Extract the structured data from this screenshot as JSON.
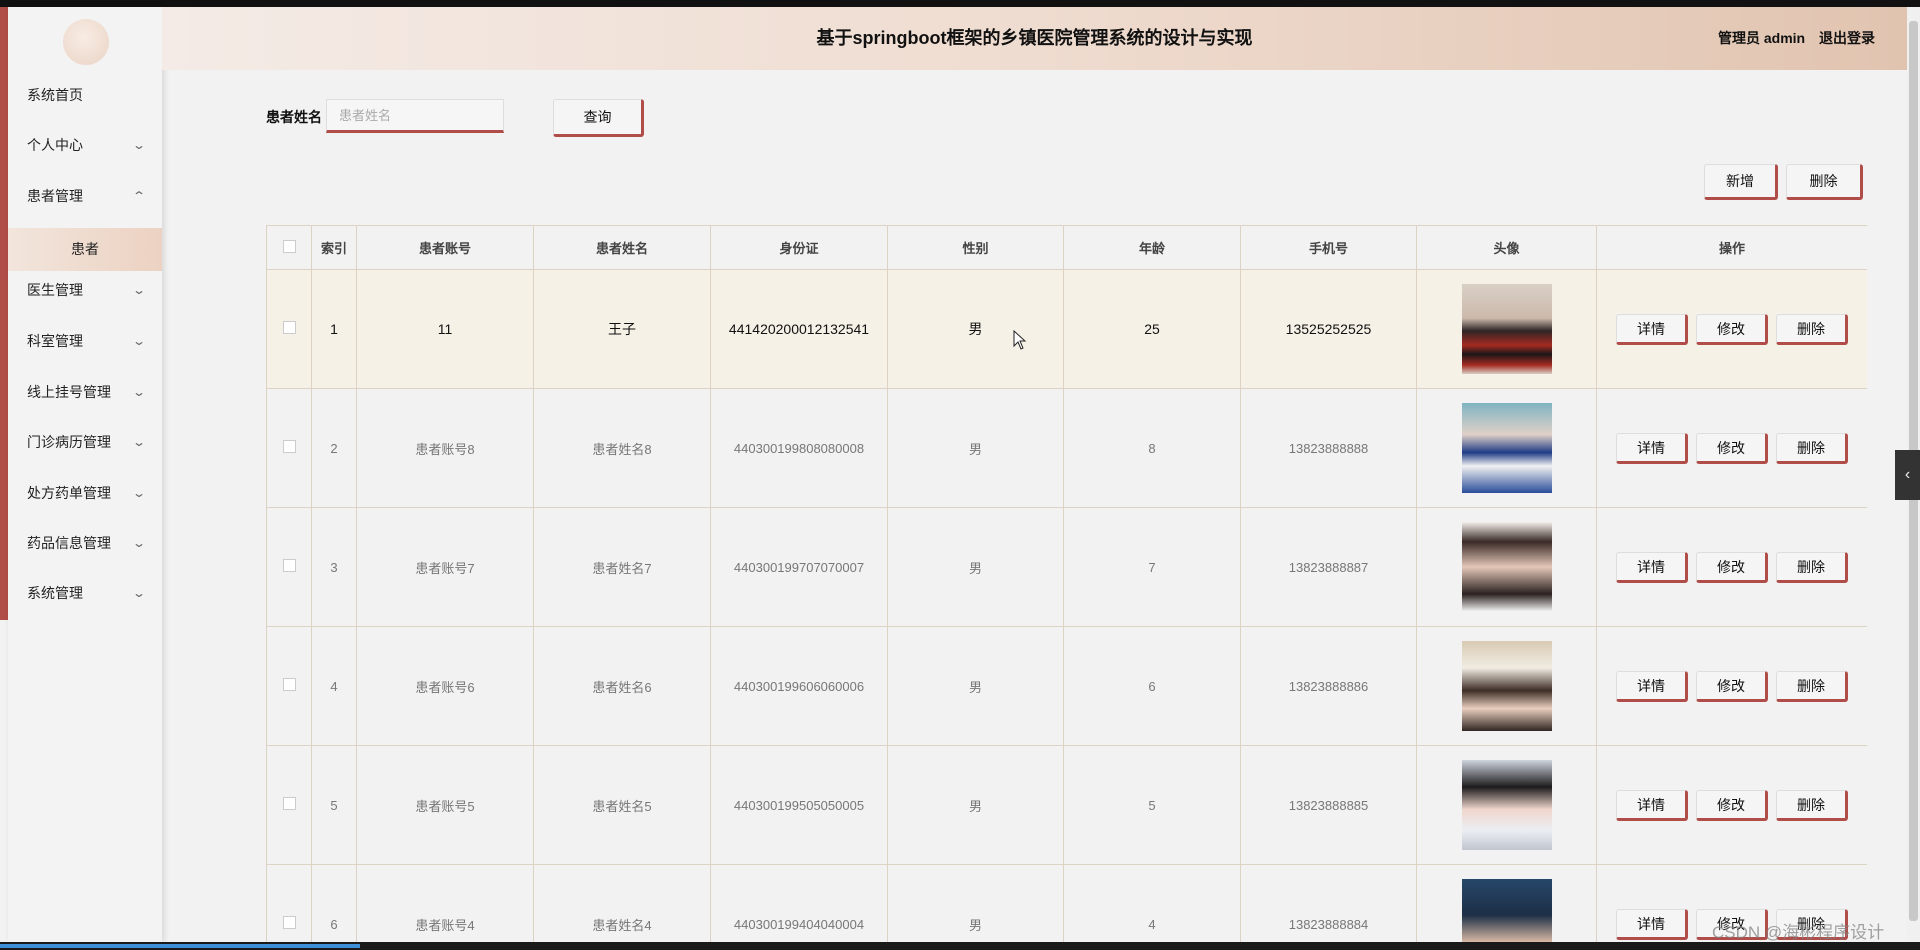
{
  "app": {
    "title": "基于springboot框架的乡镇医院管理系统的设计与实现",
    "user_label": "管理员 admin",
    "logout": "退出登录"
  },
  "sidebar": {
    "items": [
      {
        "label": "系统首页",
        "expandable": false
      },
      {
        "label": "个人中心",
        "expandable": true,
        "expanded": false
      },
      {
        "label": "患者管理",
        "expandable": true,
        "expanded": true
      },
      {
        "label": "医生管理",
        "expandable": true,
        "expanded": false
      },
      {
        "label": "科室管理",
        "expandable": true,
        "expanded": false
      },
      {
        "label": "线上挂号管理",
        "expandable": true,
        "expanded": false
      },
      {
        "label": "门诊病历管理",
        "expandable": true,
        "expanded": false
      },
      {
        "label": "处方药单管理",
        "expandable": true,
        "expanded": false
      },
      {
        "label": "药品信息管理",
        "expandable": true,
        "expanded": false
      },
      {
        "label": "系统管理",
        "expandable": true,
        "expanded": false
      }
    ],
    "active_sub": "患者"
  },
  "search": {
    "label": "患者姓名",
    "placeholder": "患者姓名",
    "value": "",
    "button": "查询"
  },
  "actions": {
    "add": "新增",
    "delete": "删除"
  },
  "table": {
    "headers": [
      "",
      "索引",
      "患者账号",
      "患者姓名",
      "身份证",
      "性别",
      "年龄",
      "手机号",
      "头像",
      "操作"
    ],
    "row_buttons": {
      "detail": "详情",
      "edit": "修改",
      "delete": "删除"
    },
    "rows": [
      {
        "index": "1",
        "account": "11",
        "name": "王子",
        "id_card": "441420200012132541",
        "gender": "男",
        "age": "25",
        "phone": "13525252525",
        "avatar": "avatar-1"
      },
      {
        "index": "2",
        "account": "患者账号8",
        "name": "患者姓名8",
        "id_card": "440300199808080008",
        "gender": "男",
        "age": "8",
        "phone": "13823888888",
        "avatar": "avatar-2"
      },
      {
        "index": "3",
        "account": "患者账号7",
        "name": "患者姓名7",
        "id_card": "440300199707070007",
        "gender": "男",
        "age": "7",
        "phone": "13823888887",
        "avatar": "avatar-3"
      },
      {
        "index": "4",
        "account": "患者账号6",
        "name": "患者姓名6",
        "id_card": "440300199606060006",
        "gender": "男",
        "age": "6",
        "phone": "13823888886",
        "avatar": "avatar-4"
      },
      {
        "index": "5",
        "account": "患者账号5",
        "name": "患者姓名5",
        "id_card": "440300199505050005",
        "gender": "男",
        "age": "5",
        "phone": "13823888885",
        "avatar": "avatar-5"
      },
      {
        "index": "6",
        "account": "患者账号4",
        "name": "患者姓名4",
        "id_card": "440300199404040004",
        "gender": "男",
        "age": "4",
        "phone": "13823888884",
        "avatar": "avatar-6"
      }
    ]
  },
  "watermark": "CSDN @海彬程序设计",
  "colors": {
    "accent": "#b14d48",
    "header_start": "#f4ebe6",
    "header_end": "#e1c4b0"
  }
}
